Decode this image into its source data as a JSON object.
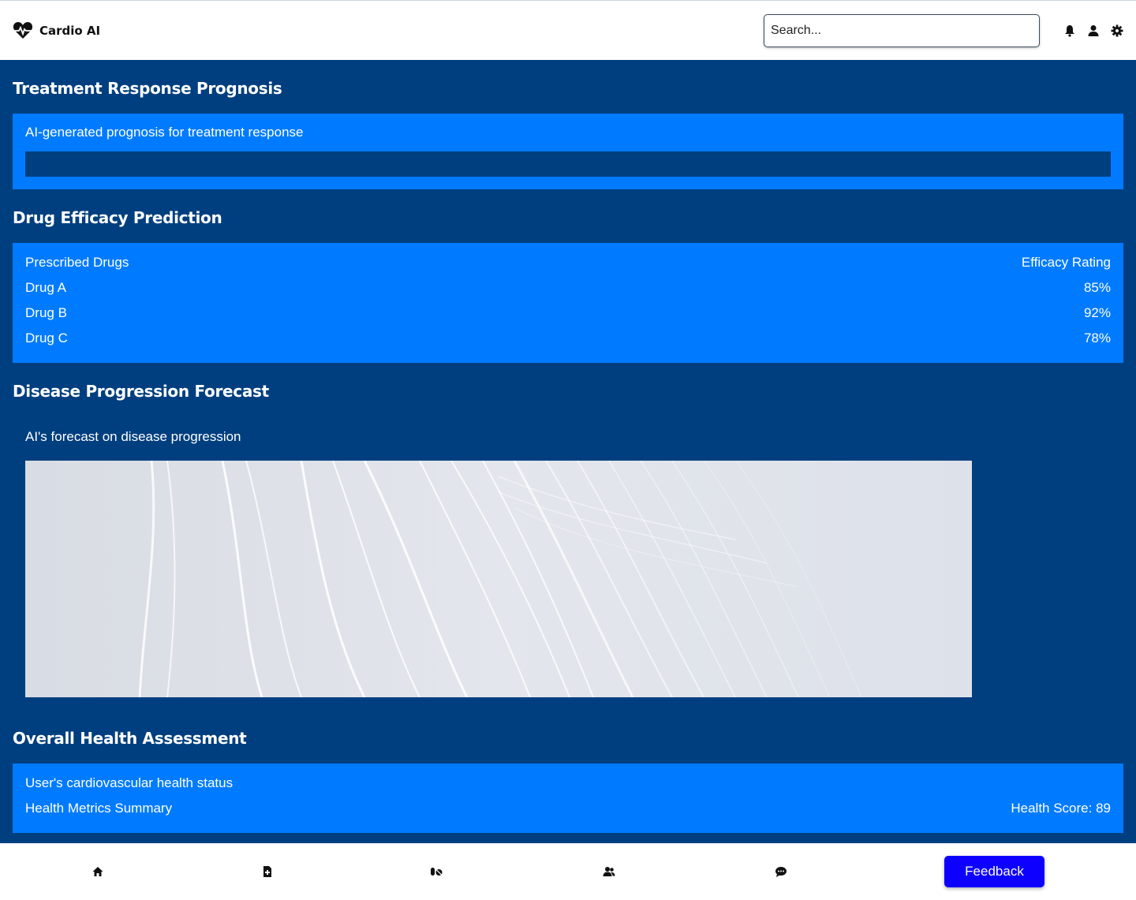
{
  "header": {
    "app_name": "Cardio AI",
    "logo_icon": "heart-pulse-icon",
    "search": {
      "placeholder": "Search...",
      "value": ""
    },
    "icons": [
      "bell-icon",
      "user-icon",
      "gear-icon"
    ]
  },
  "sections": {
    "treatment": {
      "title": "Treatment Response Prognosis",
      "description": "AI-generated prognosis for treatment response",
      "progress": 0
    },
    "drug_efficacy": {
      "title": "Drug Efficacy Prediction",
      "columns": [
        "Prescribed Drugs",
        "Efficacy Rating"
      ],
      "rows": [
        {
          "drug": "Drug A",
          "rating": "85%"
        },
        {
          "drug": "Drug B",
          "rating": "92%"
        },
        {
          "drug": "Drug C",
          "rating": "78%"
        }
      ]
    },
    "disease_progression": {
      "title": "Disease Progression Forecast",
      "caption": "AI's forecast on disease progression"
    },
    "health_assessment": {
      "title": "Overall Health Assessment",
      "status": "User's cardiovascular health status",
      "summary_label": "Health Metrics Summary",
      "score": "Health Score: 89"
    }
  },
  "bottom_nav": {
    "items": [
      "home-icon",
      "file-medical-icon",
      "pills-icon",
      "users-icon",
      "chat-icon"
    ],
    "feedback_label": "Feedback"
  },
  "colors": {
    "background": "#003f7f",
    "panel": "#007bff",
    "feedback_button": "#0d00ff"
  }
}
